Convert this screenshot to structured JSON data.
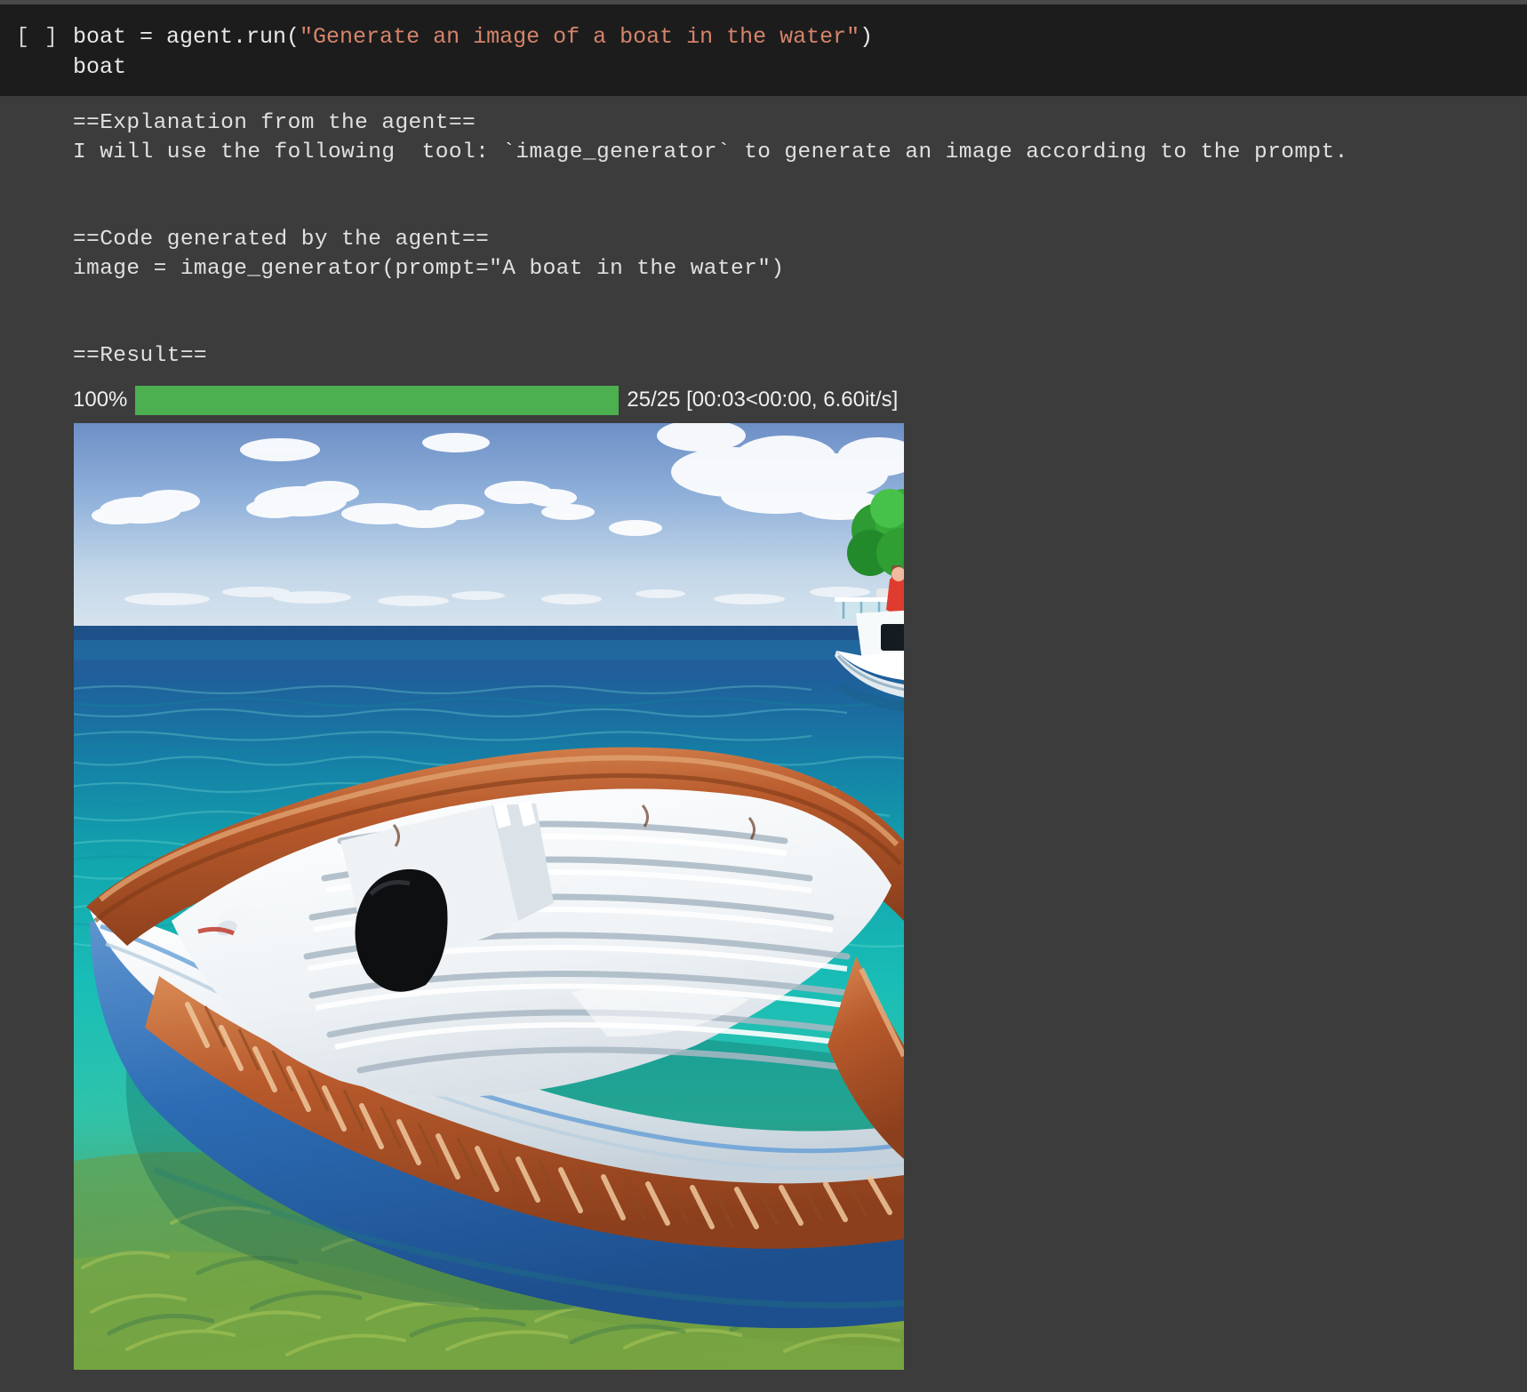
{
  "cell": {
    "prompt_marker": "[ ]",
    "code": {
      "line1_pre": "boat = agent.run(",
      "line1_string": "\"Generate an image of a boat in the water\"",
      "line1_post": ")",
      "line2": "boat"
    }
  },
  "output": {
    "explanation_header": "==Explanation from the agent==",
    "explanation_body": "I will use the following  tool: `image_generator` to generate an image according to the prompt.",
    "code_header": "==Code generated by the agent==",
    "code_body": "image = image_generator(prompt=\"A boat in the water\")",
    "result_header": "==Result=="
  },
  "progress": {
    "percent_label": "100%",
    "percent_value": 100,
    "stats": "25/25 [00:03<00:00, 6.60it/s]",
    "current": 25,
    "total": 25,
    "elapsed": "00:03",
    "remaining": "00:00",
    "rate": "6.60it/s",
    "bar_color": "#4caf50"
  },
  "image": {
    "alt": "A boat in the water",
    "description": "Photorealistic rowing boat with varnished wood gunwale and blue-and-white hull floating on clear turquoise water; a white motor yacht with a green tree on deck sits at the horizon on the right under a blue sky with scattered clouds.",
    "palette": {
      "sky_top": "#6f92c8",
      "sky_bottom": "#cfe0ee",
      "sea_deep": "#2e5f96",
      "sea_turquoise": "#20c0bd",
      "sea_green": "#79a83f",
      "hull_blue": "#2f6fb5",
      "hull_white": "#f2f6f8",
      "wood": "#b3542a"
    }
  },
  "theme": {
    "code_bg": "#1c1c1c",
    "output_bg": "#3c3c3c",
    "text": "#e8e8e8",
    "string_token": "#d6846a"
  }
}
